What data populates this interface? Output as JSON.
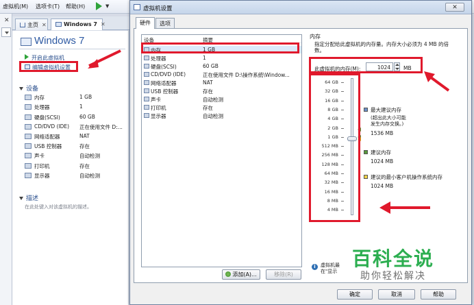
{
  "menubar": {
    "items": [
      "虚拟机(M)",
      "选项卡(T)",
      "帮助(H)"
    ]
  },
  "tabs": [
    {
      "label": "主页"
    },
    {
      "label": "Windows 7"
    }
  ],
  "vm": {
    "title": "Windows 7",
    "commands": [
      "开启此虚拟机",
      "编辑虚拟机设置"
    ],
    "devices_header": "设备",
    "devices": [
      {
        "name": "内存",
        "value": "1 GB",
        "icon": "memory-icon"
      },
      {
        "name": "处理器",
        "value": "1",
        "icon": "cpu-icon"
      },
      {
        "name": "硬盘(SCSI)",
        "value": "60 GB",
        "icon": "hard-disk-icon"
      },
      {
        "name": "CD/DVD (IDE)",
        "value": "正在使用文件 D:...",
        "icon": "cd-dvd-icon"
      },
      {
        "name": "网络适配器",
        "value": "NAT",
        "icon": "network-adapter-icon"
      },
      {
        "name": "USB 控制器",
        "value": "存在",
        "icon": "usb-icon"
      },
      {
        "name": "声卡",
        "value": "自动检测",
        "icon": "sound-card-icon"
      },
      {
        "name": "打印机",
        "value": "存在",
        "icon": "printer-icon"
      },
      {
        "name": "显示器",
        "value": "自动检测",
        "icon": "display-icon"
      }
    ],
    "description_header": "描述",
    "description_placeholder": "在此处键入对该虚拟机的描述。"
  },
  "dialog": {
    "title": "虚拟机设置",
    "close_label": "✕",
    "tabs": [
      "硬件",
      "选项"
    ],
    "list_headers": {
      "device": "设备",
      "summary": "摘要"
    },
    "devices": [
      {
        "name": "内存",
        "value": "1 GB",
        "selected": true
      },
      {
        "name": "处理器",
        "value": "1"
      },
      {
        "name": "硬盘(SCSI)",
        "value": "60 GB"
      },
      {
        "name": "CD/DVD (IDE)",
        "value": "正在使用文件 D:\\操作系统\\Window..."
      },
      {
        "name": "网络适配器",
        "value": "NAT"
      },
      {
        "name": "USB 控制器",
        "value": "存在"
      },
      {
        "name": "声卡",
        "value": "自动检测"
      },
      {
        "name": "打印机",
        "value": "存在"
      },
      {
        "name": "显示器",
        "value": "自动检测"
      }
    ],
    "add_button": "添加(A)...",
    "remove_button": "移除(R)",
    "memory": {
      "section_title": "内存",
      "description": "指定分配给此虚拟机的内存量。内存大小必须为 4 MB 的倍数。",
      "field_label": "此虚拟机的内存(M):",
      "value": "1024",
      "unit": "MB",
      "scale": [
        "64 GB",
        "32 GB",
        "16 GB",
        "8 GB",
        "4 GB",
        "2 GB",
        "1 GB",
        "512 MB",
        "256 MB",
        "128 MB",
        "64 MB",
        "32 MB",
        "16 MB",
        "8 MB",
        "4 MB"
      ],
      "max_recommended": {
        "title": "最大建议内存",
        "note_line1": "(超出此大小可能",
        "note_line2": "发生内存交换。)",
        "value": "1536 MB"
      },
      "recommended": {
        "title": "建议内存",
        "value": "1024 MB"
      },
      "guest_min": {
        "title": "建议的最小客户机操作系统内存",
        "value": "1024 MB"
      },
      "info_line1": "虚拟机最",
      "info_line2": "在\"显示"
    },
    "buttons": {
      "ok": "确定",
      "cancel": "取消",
      "help": "帮助"
    }
  },
  "watermark": {
    "logo": "百科全说",
    "sub": "助你轻松解决"
  },
  "colors": {
    "annotation": "#e0192c",
    "link": "#2a4f8d",
    "accent_green": "#2cae50"
  }
}
